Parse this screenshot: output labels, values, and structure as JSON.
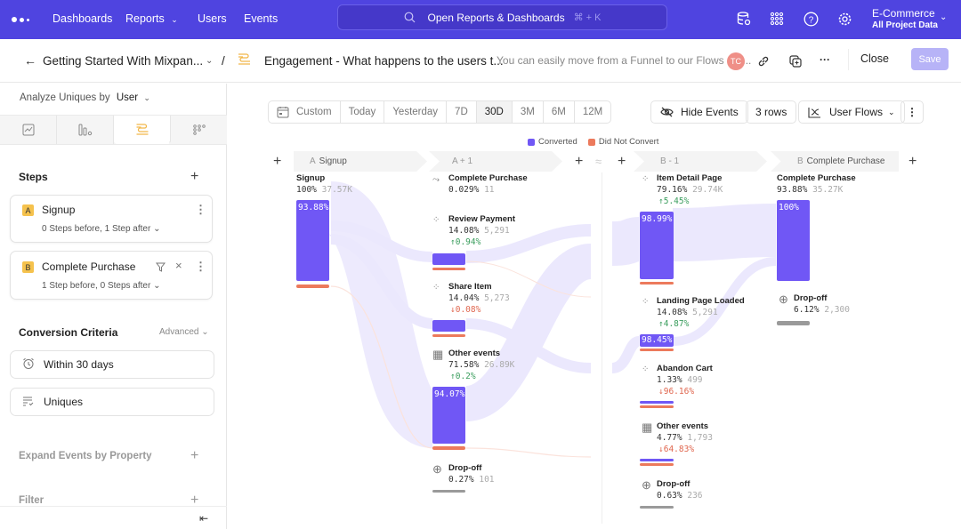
{
  "topnav": {
    "items": [
      "Dashboards",
      "Reports",
      "Users",
      "Events"
    ],
    "search_placeholder": "Open Reports & Dashboards",
    "search_shortcut": "⌘ + K",
    "project_name": "E-Commerce",
    "project_scope": "All Project Data"
  },
  "header": {
    "breadcrumb_parent": "Getting Started With Mixpan...",
    "separator": "/",
    "report_title": "Engagement - What happens to the users t...",
    "description": "You can easily move from a Funnel to our Flows rep...",
    "avatar_initials": "TC",
    "close_label": "Close",
    "save_label": "Save"
  },
  "sidebar": {
    "analyze_label": "Analyze Uniques by",
    "analyze_value": "User",
    "steps_title": "Steps",
    "steps": [
      {
        "badge": "A",
        "name": "Signup",
        "sub": "0 Steps before, 1 Step after"
      },
      {
        "badge": "B",
        "name": "Complete Purchase",
        "sub": "1 Step before, 0 Steps after"
      }
    ],
    "conversion_title": "Conversion Criteria",
    "conversion_advanced": "Advanced",
    "criteria": [
      "Within 30 days",
      "Uniques"
    ],
    "expand_title": "Expand Events by Property",
    "filter_title": "Filter"
  },
  "toolbar": {
    "date_ranges": [
      "Custom",
      "Today",
      "Yesterday",
      "7D",
      "30D",
      "3M",
      "6M",
      "12M"
    ],
    "selected_range": "30D",
    "hide_events": "Hide Events",
    "rows": "3 rows",
    "view": "User Flows"
  },
  "legend": {
    "converted": "Converted",
    "not_converted": "Did Not Convert",
    "converted_color": "#7057f5",
    "not_converted_color": "#ec7a5c"
  },
  "columns": [
    {
      "prefix": "A",
      "label": "Signup"
    },
    {
      "prefix": "",
      "label": "A + 1"
    },
    {
      "prefix": "",
      "label": "B - 1"
    },
    {
      "prefix": "B",
      "label": "Complete Purchase"
    }
  ],
  "flow": {
    "col_a": [
      {
        "name": "Signup",
        "pct": "100%",
        "count": "37.57K",
        "bar_label": "93.88%"
      }
    ],
    "col_a1": [
      {
        "name": "Complete Purchase",
        "pct": "0.029%",
        "count": "11"
      },
      {
        "name": "Review Payment",
        "pct": "14.08%",
        "count": "5,291",
        "delta": "↑0.94%",
        "dir": "up"
      },
      {
        "name": "Share Item",
        "pct": "14.04%",
        "count": "5,273",
        "delta": "↓0.08%",
        "dir": "down"
      },
      {
        "name": "Other events",
        "pct": "71.58%",
        "count": "26.89K",
        "delta": "↑0.2%",
        "dir": "up",
        "bar_label": "94.07%"
      },
      {
        "name": "Drop-off",
        "pct": "0.27%",
        "count": "101"
      }
    ],
    "col_b1": [
      {
        "name": "Item Detail Page",
        "pct": "79.16%",
        "count": "29.74K",
        "delta": "↑5.45%",
        "dir": "up",
        "bar_label": "98.99%"
      },
      {
        "name": "Landing Page Loaded",
        "pct": "14.08%",
        "count": "5,291",
        "delta": "↑4.87%",
        "dir": "up",
        "bar_label": "98.45%"
      },
      {
        "name": "Abandon Cart",
        "pct": "1.33%",
        "count": "499",
        "delta": "↓96.16%",
        "dir": "down"
      },
      {
        "name": "Other events",
        "pct": "4.77%",
        "count": "1,793",
        "delta": "↓64.83%",
        "dir": "down"
      },
      {
        "name": "Drop-off",
        "pct": "0.63%",
        "count": "236"
      }
    ],
    "col_b": [
      {
        "name": "Complete Purchase",
        "pct": "93.88%",
        "count": "35.27K",
        "bar_label": "100%"
      },
      {
        "name": "Drop-off",
        "pct": "6.12%",
        "count": "2,300"
      }
    ]
  }
}
